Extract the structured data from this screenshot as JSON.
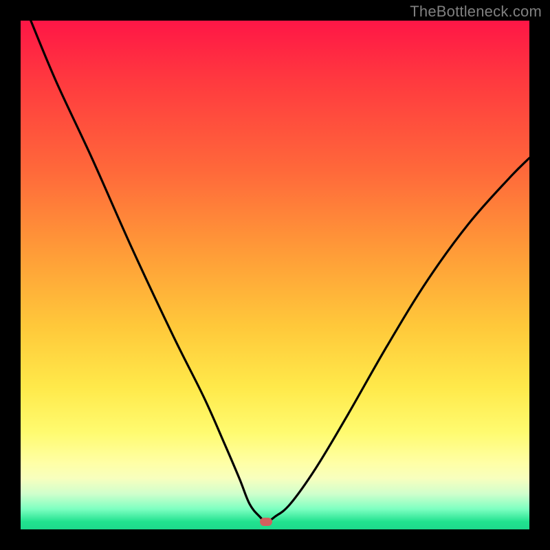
{
  "watermark": "TheBottleneck.com",
  "colors": {
    "background": "#000000",
    "gradient_top": "#ff1646",
    "gradient_bottom": "#1ed98c",
    "curve": "#000000",
    "marker": "#d2605e",
    "watermark_text": "#808080"
  },
  "chart_data": {
    "type": "line",
    "title": "",
    "xlabel": "",
    "ylabel": "",
    "xlim": [
      0,
      100
    ],
    "ylim": [
      0,
      100
    ],
    "grid": false,
    "legend": false,
    "annotations": [
      {
        "name": "marker",
        "x": 48.3,
        "y": 1.5
      }
    ],
    "series": [
      {
        "name": "bottleneck-curve",
        "x": [
          2,
          7,
          14,
          22,
          30,
          36,
          40,
          43,
          45,
          47,
          48.3,
          50,
          53,
          58,
          64,
          72,
          80,
          88,
          96,
          100
        ],
        "y": [
          100,
          88,
          73,
          55,
          38,
          26,
          17,
          10,
          5,
          2.5,
          1.5,
          2.5,
          5,
          12,
          22,
          36,
          49,
          60,
          69,
          73
        ]
      }
    ]
  }
}
